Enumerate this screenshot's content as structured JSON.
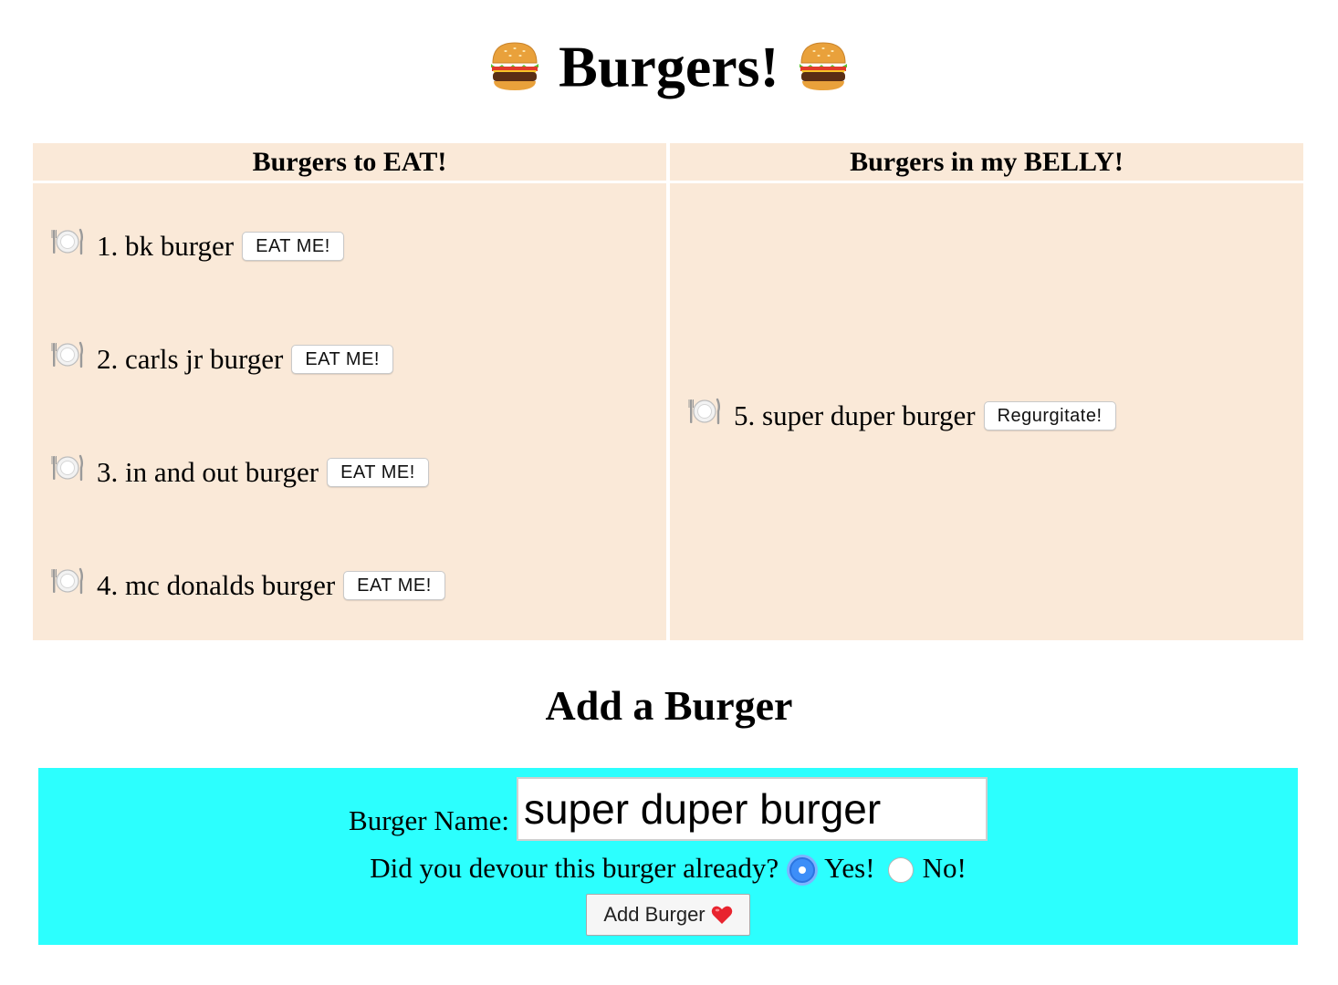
{
  "header": {
    "title": "Burgers!",
    "icon": "hamburger-icon"
  },
  "columns": {
    "to_eat": {
      "heading": "Burgers to EAT!",
      "items": [
        {
          "label": "1. bk burger",
          "button": "EAT ME!"
        },
        {
          "label": "2. carls jr burger",
          "button": "EAT ME!"
        },
        {
          "label": "3. in and out burger",
          "button": "EAT ME!"
        },
        {
          "label": "4. mc donalds burger",
          "button": "EAT ME!"
        }
      ]
    },
    "eaten": {
      "heading": "Burgers in my BELLY!",
      "items": [
        {
          "label": "5. super duper burger",
          "button": "Regurgitate!"
        }
      ]
    },
    "item_icon": "plate-with-cutlery-icon",
    "background": "#fae9d8"
  },
  "add_form": {
    "heading": "Add a Burger",
    "name_label": "Burger Name:",
    "name_value": "super duper burger",
    "devoured_question": "Did you devour this burger already?",
    "options": [
      {
        "label": "Yes!",
        "checked": true
      },
      {
        "label": "No!",
        "checked": false
      }
    ],
    "submit_label": "Add Burger",
    "submit_icon": "heart-icon",
    "background": "#2cfffe"
  }
}
